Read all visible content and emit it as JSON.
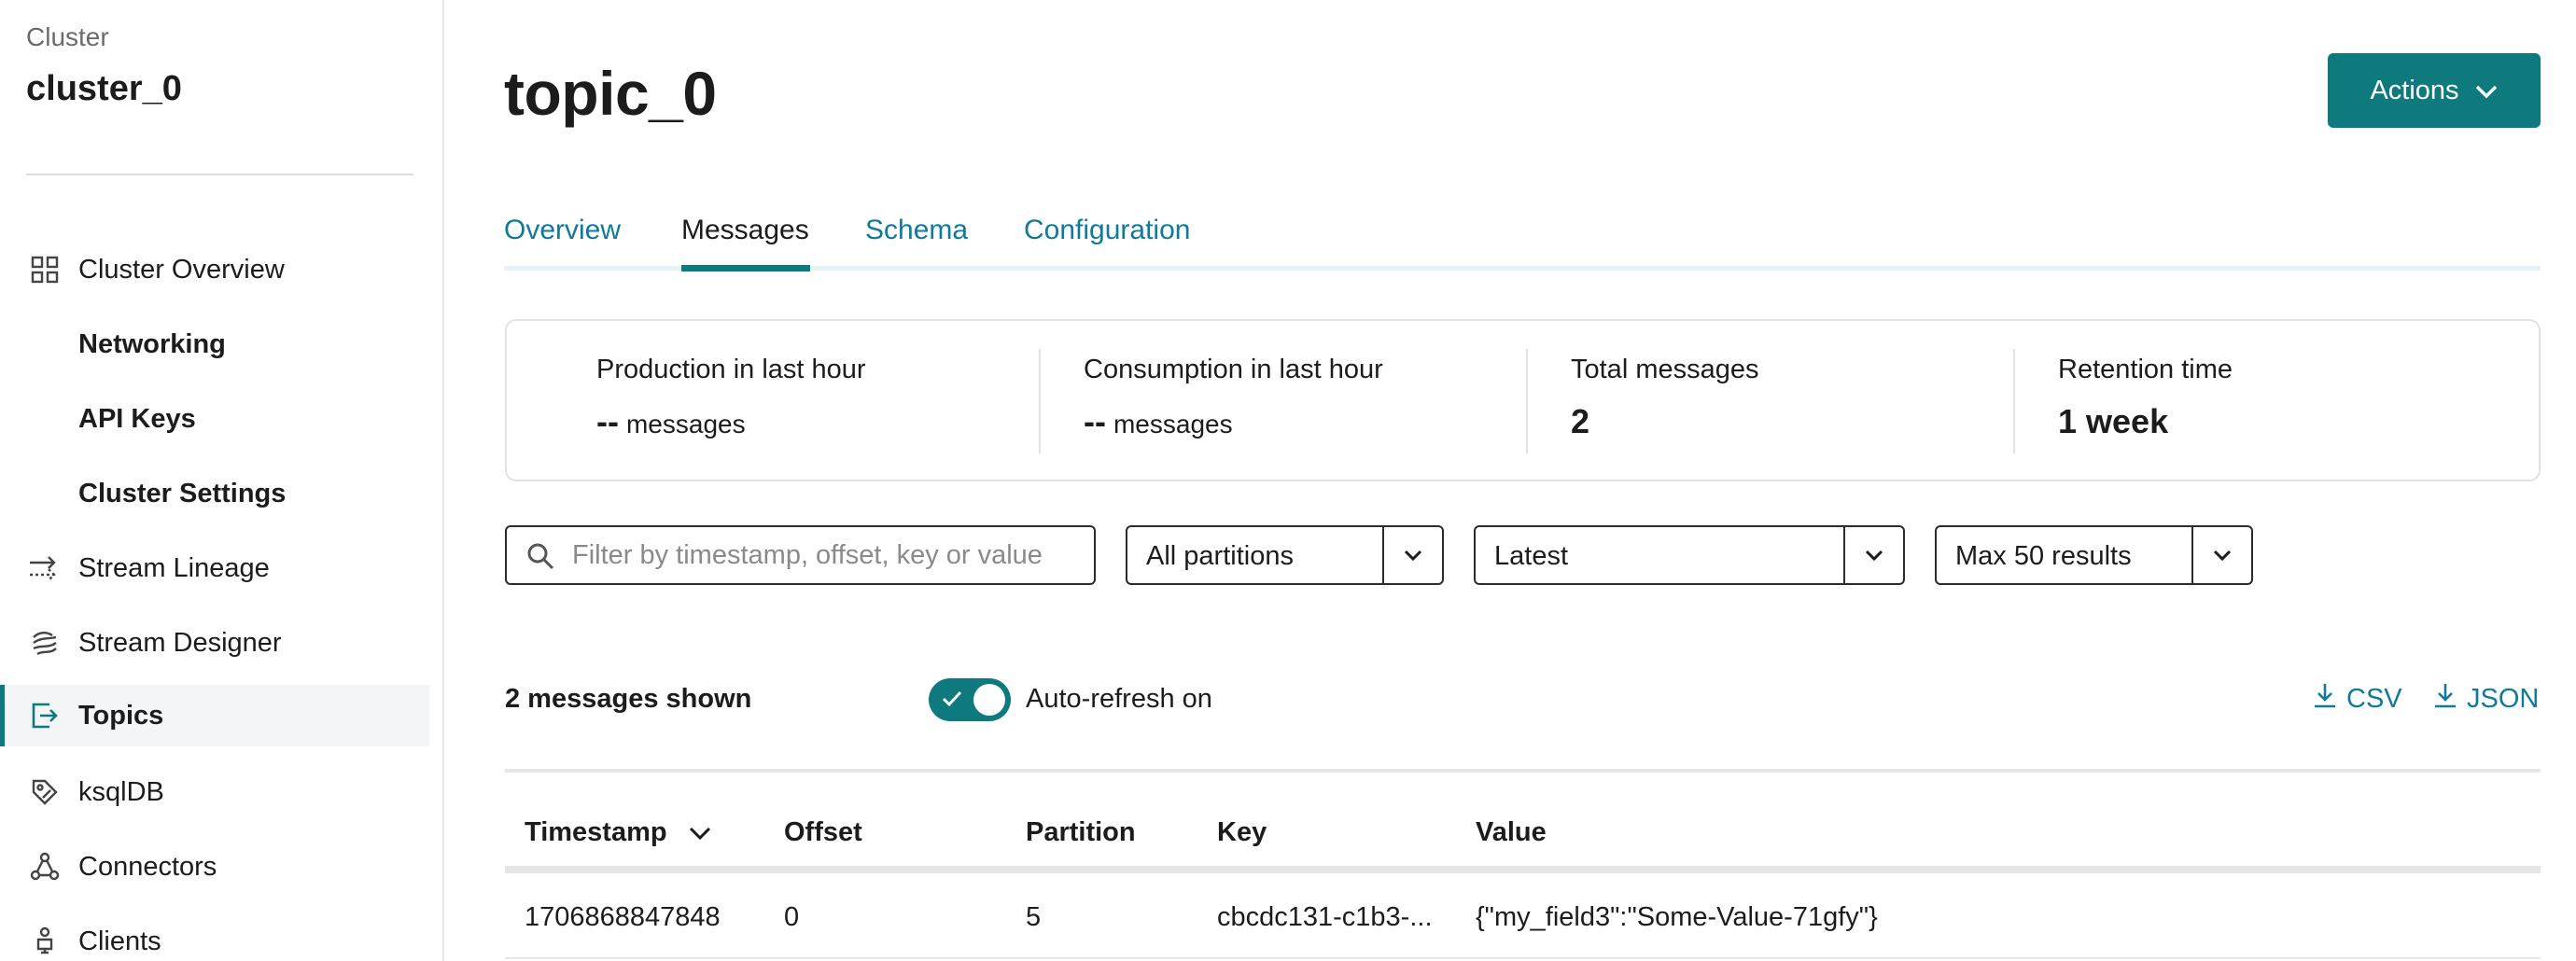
{
  "sidebar": {
    "cluster_label": "Cluster",
    "cluster_name": "cluster_0",
    "items": [
      {
        "label": "Cluster Overview",
        "icon": "grid-icon"
      },
      {
        "label": "Networking"
      },
      {
        "label": "API Keys"
      },
      {
        "label": "Cluster Settings"
      },
      {
        "label": "Stream Lineage",
        "icon": "lineage-icon"
      },
      {
        "label": "Stream Designer",
        "icon": "designer-icon"
      },
      {
        "label": "Topics",
        "icon": "topics-icon",
        "active": true
      },
      {
        "label": "ksqlDB",
        "icon": "ksqldb-icon"
      },
      {
        "label": "Connectors",
        "icon": "connectors-icon"
      },
      {
        "label": "Clients",
        "icon": "clients-icon"
      }
    ]
  },
  "header": {
    "title": "topic_0",
    "actions_label": "Actions"
  },
  "tabs": [
    "Overview",
    "Messages",
    "Schema",
    "Configuration"
  ],
  "active_tab": "Messages",
  "stats": [
    {
      "label": "Production in last hour",
      "value": "--",
      "unit": "messages"
    },
    {
      "label": "Consumption in last hour",
      "value": "--",
      "unit": "messages"
    },
    {
      "label": "Total messages",
      "value": "2",
      "unit": ""
    },
    {
      "label": "Retention time",
      "value": "1 week",
      "unit": ""
    }
  ],
  "filters": {
    "search_placeholder": "Filter by timestamp, offset, key or value",
    "partitions": "All partitions",
    "offset": "Latest",
    "max_results": "Max 50 results"
  },
  "messages_shown": "2 messages shown",
  "auto_refresh_label": "Auto-refresh on",
  "downloads": {
    "csv": "CSV",
    "json": "JSON"
  },
  "table": {
    "headers": [
      "Timestamp",
      "Offset",
      "Partition",
      "Key",
      "Value"
    ],
    "rows": [
      [
        "1706868847848",
        "0",
        "5",
        "cbcdc131-c1b3-...",
        "{\"my_field3\":\"Some-Value-71gfy\"}"
      ]
    ]
  },
  "colors": {
    "accent": "#0f7a7e",
    "link": "#0f7a9a"
  }
}
